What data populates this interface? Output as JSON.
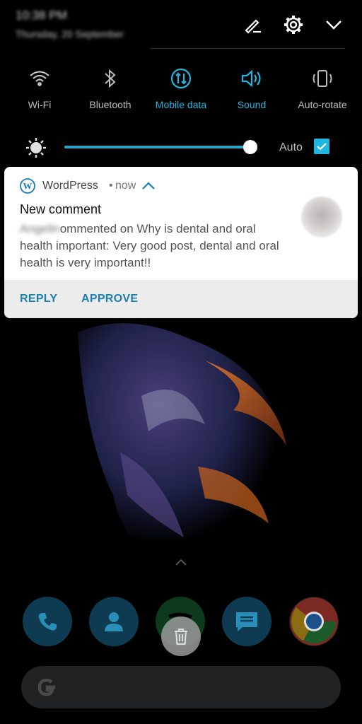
{
  "header": {
    "time": "10:38 PM",
    "date": "Thursday, 20 September",
    "icons": [
      "edit-icon",
      "settings-icon",
      "collapse-icon"
    ]
  },
  "quick_tiles": [
    {
      "label": "Wi-Fi",
      "icon": "wifi-icon",
      "active": false
    },
    {
      "label": "Bluetooth",
      "icon": "bluetooth-icon",
      "active": false
    },
    {
      "label": "Mobile data",
      "icon": "mobile-data-icon",
      "active": true
    },
    {
      "label": "Sound",
      "icon": "sound-icon",
      "active": true
    },
    {
      "label": "Auto-rotate",
      "icon": "auto-rotate-icon",
      "active": false
    }
  ],
  "brightness": {
    "level": 0.95,
    "auto_label": "Auto",
    "auto_checked": true
  },
  "notification": {
    "app_name": "WordPress",
    "separator": "•",
    "time": "now",
    "title": "New comment",
    "author": "Angelin",
    "body_start": "ommented on Why is dental and oral health important: Very good post, dental and oral health is very important!!",
    "actions": [
      "REPLY",
      "APPROVE"
    ]
  },
  "colors": {
    "accent": "#20b6e0",
    "action": "#1a7fb3",
    "card_bg": "#ffffff",
    "actions_bg": "#ececec"
  },
  "dock": {
    "apps": [
      "phone-icon",
      "contacts-icon",
      "spotify-icon",
      "messages-icon",
      "chrome-icon"
    ],
    "search_icon": "google-g-icon"
  }
}
